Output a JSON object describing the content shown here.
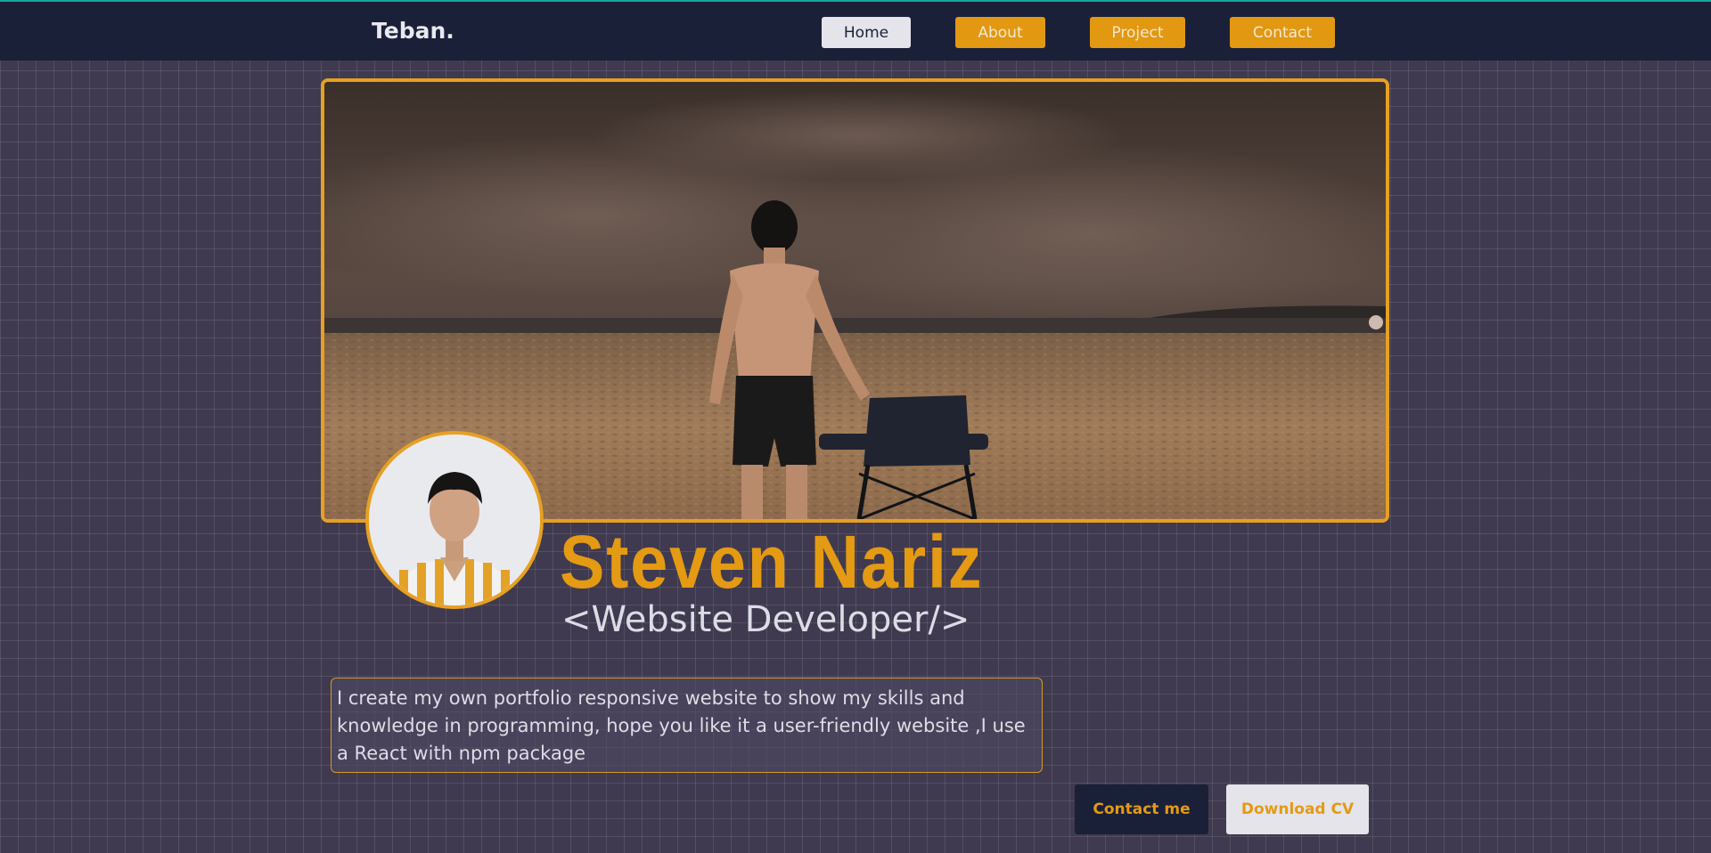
{
  "nav": {
    "brand": "Teban.",
    "items": [
      {
        "label": "Home"
      },
      {
        "label": "About"
      },
      {
        "label": "Project"
      },
      {
        "label": "Contact"
      }
    ]
  },
  "profile": {
    "name": "Steven Nariz",
    "role": "<Website Developer/>",
    "description": "I create my own portfolio responsive website to show my skills and knowledge in programming, hope you like it a user-friendly website ,I use a React with npm package"
  },
  "actions": {
    "contact_label": "Contact me",
    "download_label": "Download CV"
  },
  "colors": {
    "accent": "#e49a13",
    "navbar": "#1b2039",
    "background": "#3f3a4f"
  }
}
